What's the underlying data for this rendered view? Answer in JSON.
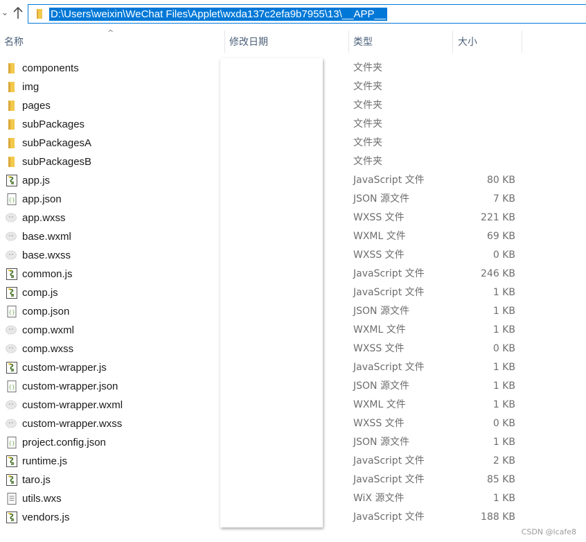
{
  "address_bar": {
    "path": "D:\\Users\\weixin\\WeChat Files\\Applet\\wxda137c2efa9b7955\\13\\__APP__"
  },
  "columns": {
    "name": "名称",
    "date_modified": "修改日期",
    "type": "类型",
    "size": "大小"
  },
  "files": [
    {
      "name": "components",
      "type": "文件夹",
      "size": "",
      "icon": "folder-icon"
    },
    {
      "name": "img",
      "type": "文件夹",
      "size": "",
      "icon": "folder-icon"
    },
    {
      "name": "pages",
      "type": "文件夹",
      "size": "",
      "icon": "folder-icon"
    },
    {
      "name": "subPackages",
      "type": "文件夹",
      "size": "",
      "icon": "folder-icon"
    },
    {
      "name": "subPackagesA",
      "type": "文件夹",
      "size": "",
      "icon": "folder-icon"
    },
    {
      "name": "subPackagesB",
      "type": "文件夹",
      "size": "",
      "icon": "folder-icon"
    },
    {
      "name": "app.js",
      "type": "JavaScript 文件",
      "size": "80 KB",
      "icon": "js-file-icon"
    },
    {
      "name": "app.json",
      "type": "JSON 源文件",
      "size": "7 KB",
      "icon": "json-file-icon"
    },
    {
      "name": "app.wxss",
      "type": "WXSS 文件",
      "size": "221 KB",
      "icon": "wechat-file-icon"
    },
    {
      "name": "base.wxml",
      "type": "WXML 文件",
      "size": "69 KB",
      "icon": "wechat-file-icon"
    },
    {
      "name": "base.wxss",
      "type": "WXSS 文件",
      "size": "0 KB",
      "icon": "wechat-file-icon"
    },
    {
      "name": "common.js",
      "type": "JavaScript 文件",
      "size": "246 KB",
      "icon": "js-file-icon"
    },
    {
      "name": "comp.js",
      "type": "JavaScript 文件",
      "size": "1 KB",
      "icon": "js-file-icon"
    },
    {
      "name": "comp.json",
      "type": "JSON 源文件",
      "size": "1 KB",
      "icon": "json-file-icon"
    },
    {
      "name": "comp.wxml",
      "type": "WXML 文件",
      "size": "1 KB",
      "icon": "wechat-file-icon"
    },
    {
      "name": "comp.wxss",
      "type": "WXSS 文件",
      "size": "0 KB",
      "icon": "wechat-file-icon"
    },
    {
      "name": "custom-wrapper.js",
      "type": "JavaScript 文件",
      "size": "1 KB",
      "icon": "js-file-icon"
    },
    {
      "name": "custom-wrapper.json",
      "type": "JSON 源文件",
      "size": "1 KB",
      "icon": "json-file-icon"
    },
    {
      "name": "custom-wrapper.wxml",
      "type": "WXML 文件",
      "size": "1 KB",
      "icon": "wechat-file-icon"
    },
    {
      "name": "custom-wrapper.wxss",
      "type": "WXSS 文件",
      "size": "0 KB",
      "icon": "wechat-file-icon"
    },
    {
      "name": "project.config.json",
      "type": "JSON 源文件",
      "size": "1 KB",
      "icon": "json-file-icon"
    },
    {
      "name": "runtime.js",
      "type": "JavaScript 文件",
      "size": "2 KB",
      "icon": "js-file-icon"
    },
    {
      "name": "taro.js",
      "type": "JavaScript 文件",
      "size": "85 KB",
      "icon": "js-file-icon"
    },
    {
      "name": "utils.wxs",
      "type": "WiX 源文件",
      "size": "1 KB",
      "icon": "text-file-icon"
    },
    {
      "name": "vendors.js",
      "type": "JavaScript 文件",
      "size": "188 KB",
      "icon": "js-file-icon"
    }
  ],
  "watermark": "CSDN @lcafe8",
  "colors": {
    "selection": "#0078d7",
    "folder": "#f2c94c",
    "header_text": "#4c607a",
    "secondary_text": "#6d6d6d"
  }
}
